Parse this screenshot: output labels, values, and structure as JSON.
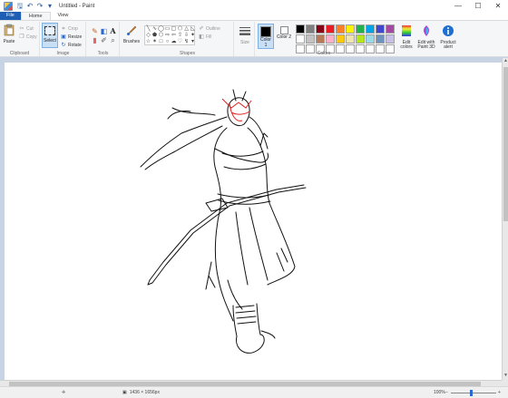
{
  "window": {
    "title": "Untitled - Paint",
    "minimize": "—",
    "maximize": "☐",
    "close": "✕"
  },
  "tabs": [
    {
      "label": "File"
    },
    {
      "label": "Home"
    },
    {
      "label": "View"
    }
  ],
  "clipboard": {
    "paste": "Paste",
    "cut": "Cut",
    "copy": "Copy",
    "group": "Clipboard"
  },
  "image": {
    "select": "Select",
    "crop": "Crop",
    "resize": "Resize",
    "rotate": "Rotate",
    "group": "Image"
  },
  "tools": {
    "group": "Tools",
    "brushes": "Brushes"
  },
  "shapes": {
    "group": "Shapes",
    "outline": "Outline",
    "fill": "Fill",
    "size": "Size"
  },
  "colors": {
    "group": "Colors",
    "color1_label": "Color 1",
    "color2_label": "Color 2",
    "color1": "#000000",
    "color2": "#ffffff",
    "edit_colors": "Edit colors",
    "edit_paint3d": "Edit with Paint 3D",
    "product_alert": "Product alert",
    "palette_row1": [
      "#000000",
      "#7f7f7f",
      "#880015",
      "#ed1c24",
      "#ff7f27",
      "#fff200",
      "#22b14c",
      "#00a2e8",
      "#3f48cc",
      "#a349a4"
    ],
    "palette_row2": [
      "#ffffff",
      "#c3c3c3",
      "#b97a57",
      "#ffaec9",
      "#ffc90e",
      "#efe4b0",
      "#b5e61d",
      "#99d9ea",
      "#7092be",
      "#c8bfe7"
    ],
    "palette_row3": [
      "#ffffff",
      "#ffffff",
      "#ffffff",
      "#ffffff",
      "#ffffff",
      "#ffffff",
      "#ffffff",
      "#ffffff",
      "#ffffff",
      "#ffffff"
    ]
  },
  "status": {
    "dimensions": "1436 × 1656px",
    "zoom": "100%",
    "zoom_minus": "−",
    "zoom_plus": "+"
  }
}
